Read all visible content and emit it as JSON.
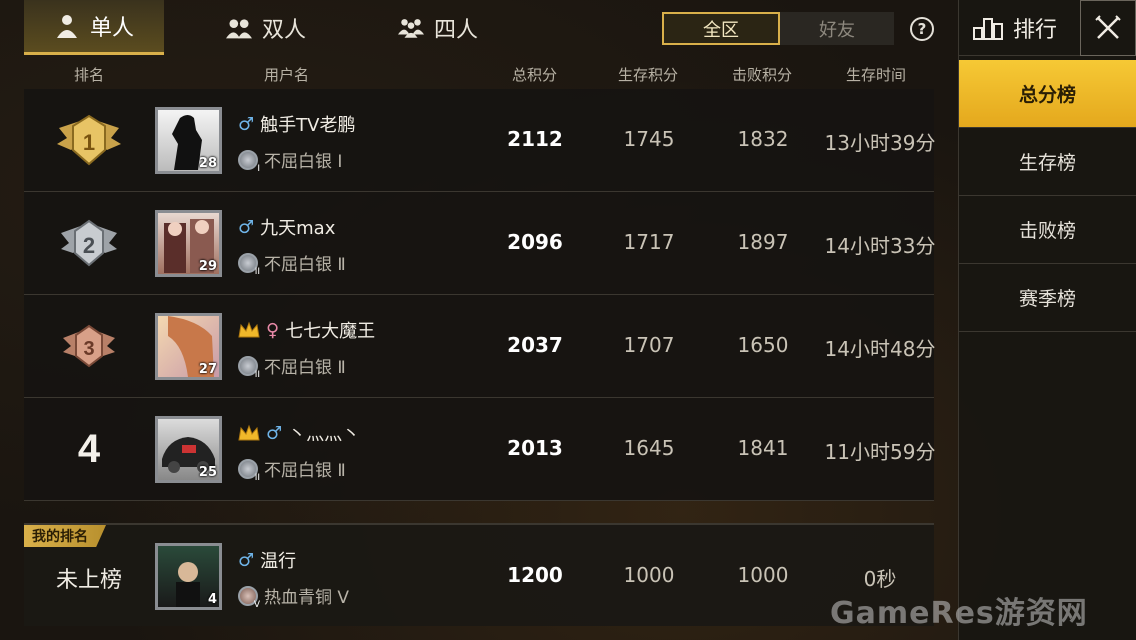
{
  "mode_tabs": [
    {
      "label": "单人",
      "icon": "single-person-icon",
      "active": true
    },
    {
      "label": "双人",
      "icon": "duo-icon",
      "active": false
    },
    {
      "label": "四人",
      "icon": "squad-icon",
      "active": false
    }
  ],
  "scope": {
    "all": "全区",
    "friends": "好友",
    "selected": "全区"
  },
  "help": "?",
  "columns": {
    "rank": "排名",
    "username": "用户名",
    "total": "总积分",
    "survival": "生存积分",
    "kills": "击败积分",
    "time": "生存时间"
  },
  "rows": [
    {
      "rank": "1",
      "name": "触手TV老鹏",
      "gender": "♂",
      "crown": false,
      "level": "28",
      "tier": "不屈白银 Ⅰ",
      "tier_sub": "I",
      "total": "2112",
      "survival": "1745",
      "kills": "1832",
      "time": "13小时39分"
    },
    {
      "rank": "2",
      "name": "九天max",
      "gender": "♂",
      "crown": false,
      "level": "29",
      "tier": "不屈白银 Ⅱ",
      "tier_sub": "II",
      "total": "2096",
      "survival": "1717",
      "kills": "1897",
      "time": "14小时33分"
    },
    {
      "rank": "3",
      "name": "七七大魔王",
      "gender": "♀",
      "crown": true,
      "level": "27",
      "tier": "不屈白银 Ⅱ",
      "tier_sub": "II",
      "total": "2037",
      "survival": "1707",
      "kills": "1650",
      "time": "14小时48分"
    },
    {
      "rank": "4",
      "name": "丶灬灬丶",
      "gender": "♂",
      "crown": true,
      "level": "25",
      "tier": "不屈白银 Ⅱ",
      "tier_sub": "II",
      "total": "2013",
      "survival": "1645",
      "kills": "1841",
      "time": "11小时59分"
    }
  ],
  "my_rank": {
    "badge": "我的排名",
    "rank_text": "未上榜",
    "name": "温行",
    "gender": "♂",
    "level": "4",
    "tier": "热血青铜 V",
    "tier_sub": "V",
    "total": "1200",
    "survival": "1000",
    "kills": "1000",
    "time": "0秒"
  },
  "right_panel": {
    "title": "排行",
    "boards": [
      {
        "label": "总分榜",
        "active": true
      },
      {
        "label": "生存榜",
        "active": false
      },
      {
        "label": "击败榜",
        "active": false
      },
      {
        "label": "赛季榜",
        "active": false
      }
    ]
  },
  "watermark": "GameRes游资网",
  "colors": {
    "accent": "#d9b04a",
    "active_board": "#f0bb2a",
    "male": "#6fb4e8",
    "female": "#e88aa8"
  }
}
